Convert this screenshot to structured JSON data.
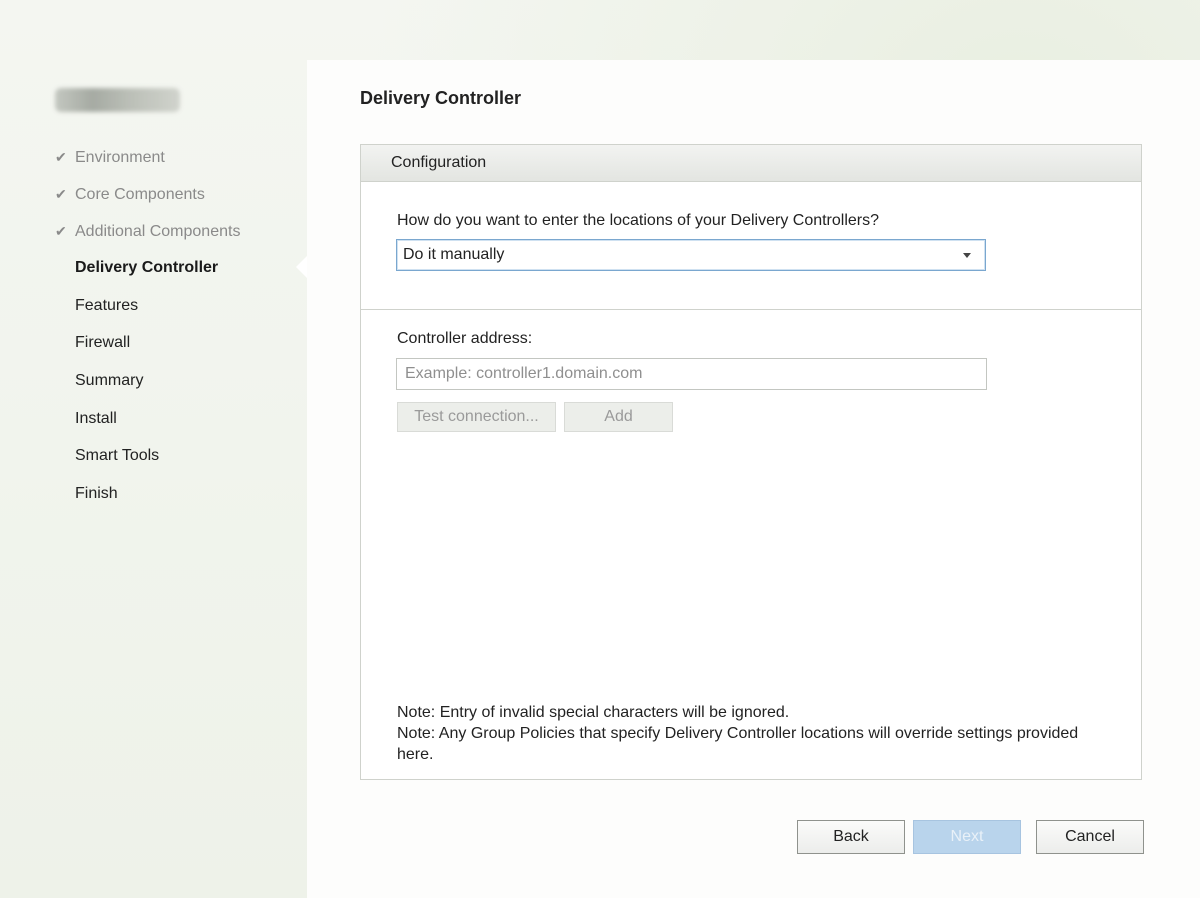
{
  "sidebar": {
    "logo": "blurred-logo",
    "items": [
      {
        "label": "Environment",
        "state": "done"
      },
      {
        "label": "Core Components",
        "state": "done"
      },
      {
        "label": "Additional Components",
        "state": "done"
      },
      {
        "label": "Delivery Controller",
        "state": "active"
      },
      {
        "label": "Features",
        "state": "todo"
      },
      {
        "label": "Firewall",
        "state": "todo"
      },
      {
        "label": "Summary",
        "state": "todo"
      },
      {
        "label": "Install",
        "state": "todo"
      },
      {
        "label": "Smart Tools",
        "state": "todo"
      },
      {
        "label": "Finish",
        "state": "todo"
      }
    ],
    "check_glyph": "✔"
  },
  "main": {
    "title": "Delivery Controller",
    "panel_header": "Configuration",
    "question": "How do you want to enter the locations of your Delivery Controllers?",
    "select_value": "Do it manually",
    "address_label": "Controller address:",
    "address_placeholder": "Example: controller1.domain.com",
    "address_value": "",
    "test_button": "Test connection...",
    "add_button": "Add",
    "note1": "Note: Entry of invalid special characters will be ignored.",
    "note2": "Note: Any Group Policies that specify Delivery Controller locations will override settings provided here."
  },
  "footer": {
    "back": "Back",
    "next": "Next",
    "cancel": "Cancel"
  },
  "colors": {
    "accent": "#7aa7cf",
    "next_disabled": "#b9d4ec",
    "background": "#f1f4ec"
  }
}
